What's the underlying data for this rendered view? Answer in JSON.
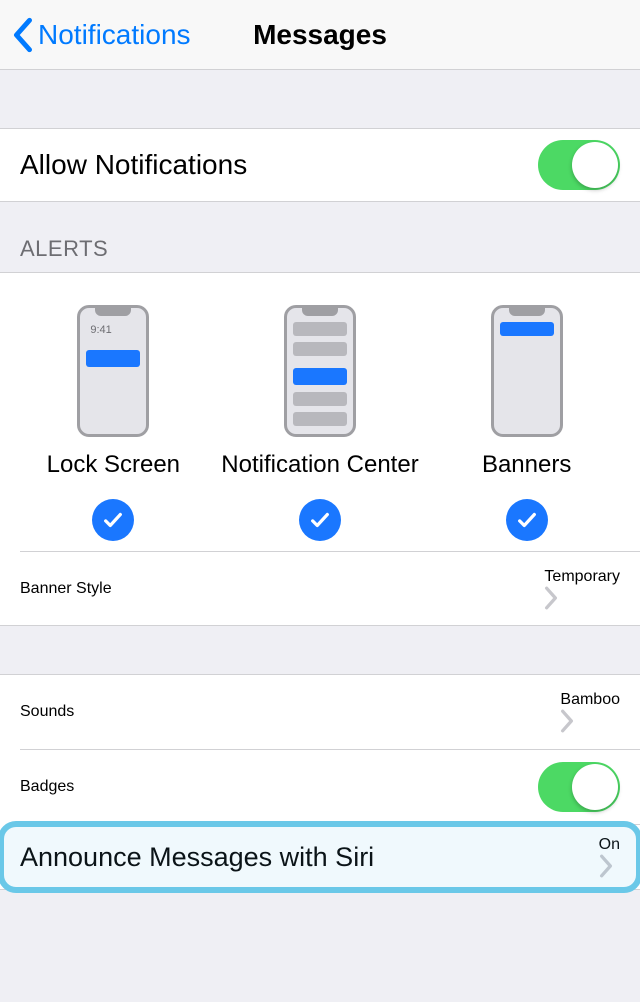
{
  "navbar": {
    "back_label": "Notifications",
    "title": "Messages"
  },
  "allow_notifications": {
    "label": "Allow Notifications",
    "value": true
  },
  "alerts": {
    "header": "ALERTS",
    "options": [
      {
        "label": "Lock Screen",
        "checked": true
      },
      {
        "label": "Notification Center",
        "checked": true
      },
      {
        "label": "Banners",
        "checked": true
      }
    ],
    "lock_time": "9:41",
    "banner_style": {
      "label": "Banner Style",
      "value": "Temporary"
    }
  },
  "options": {
    "sounds": {
      "label": "Sounds",
      "value": "Bamboo"
    },
    "badges": {
      "label": "Badges",
      "value": true
    },
    "announce": {
      "label": "Announce Messages with Siri",
      "value": "On"
    }
  }
}
